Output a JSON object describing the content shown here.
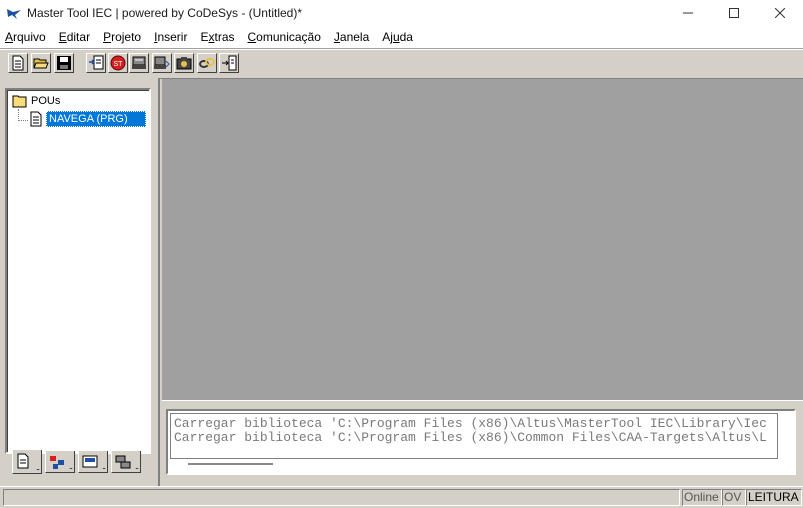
{
  "window": {
    "title": "Master Tool IEC | powered by CoDeSys - (Untitled)*",
    "controls": {
      "minimize": "—",
      "maximize": "☐",
      "close": "✕"
    }
  },
  "menu": [
    {
      "accel": "A",
      "rest": "rquivo"
    },
    {
      "accel": "E",
      "rest": "ditar"
    },
    {
      "accel": "P",
      "rest": "rojeto"
    },
    {
      "accel": "I",
      "rest": "nserir"
    },
    {
      "accel": "x",
      "pre": "E",
      "rest": "tras"
    },
    {
      "accel": "C",
      "rest": "omunicação"
    },
    {
      "accel": "J",
      "rest": "anela"
    },
    {
      "accel": "u",
      "pre": "Aj",
      "rest": "da"
    }
  ],
  "toolbar": {
    "buttons": [
      "new-file-icon",
      "open-folder-icon",
      "save-icon",
      "build-icon",
      "stop-icon",
      "login-icon",
      "logout-icon",
      "camera-icon",
      "link-icon",
      "watch-icon"
    ]
  },
  "tree": {
    "root_label": "POUs",
    "child_label": "NAVEGA (PRG)"
  },
  "bottom_tabs": [
    "pous-tab-icon",
    "datatypes-tab-icon",
    "visualizations-tab-icon",
    "resources-tab-icon"
  ],
  "messages": {
    "line1": "Carregar biblioteca 'C:\\Program Files (x86)\\Altus\\MasterTool IEC\\Library\\Iec",
    "line2": "Carregar biblioteca 'C:\\Program Files (x86)\\Common Files\\CAA-Targets\\Altus\\L"
  },
  "status": {
    "online": "Online",
    "ov": "OV",
    "mode": "LEITURA"
  },
  "colors": {
    "selection": "#0078d7",
    "workspace": "#a0a0a0",
    "chrome": "#d4d0c8"
  }
}
